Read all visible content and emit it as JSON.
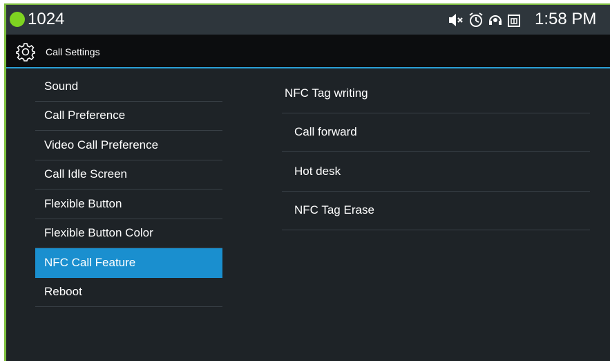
{
  "status_bar": {
    "extension": "1024",
    "icons": [
      "mute-icon",
      "alarm-icon",
      "headset-icon",
      "sim-icon"
    ],
    "time": "1:58 PM",
    "accent_color": "#7ed321"
  },
  "title_bar": {
    "icon": "gear-icon",
    "title": "Call Settings",
    "accent_color": "#2a9fd6"
  },
  "left_menu": {
    "items": [
      {
        "label": "Sound"
      },
      {
        "label": "Call Preference"
      },
      {
        "label": "Video Call Preference"
      },
      {
        "label": "Call Idle Screen"
      },
      {
        "label": "Flexible Button"
      },
      {
        "label": "Flexible Button Color"
      },
      {
        "label": "NFC Call Feature",
        "selected": true
      },
      {
        "label": "Reboot"
      }
    ]
  },
  "right_list": {
    "header": "NFC Tag writing",
    "items": [
      {
        "label": "Call forward"
      },
      {
        "label": "Hot desk"
      },
      {
        "label": "NFC Tag Erase"
      }
    ]
  }
}
